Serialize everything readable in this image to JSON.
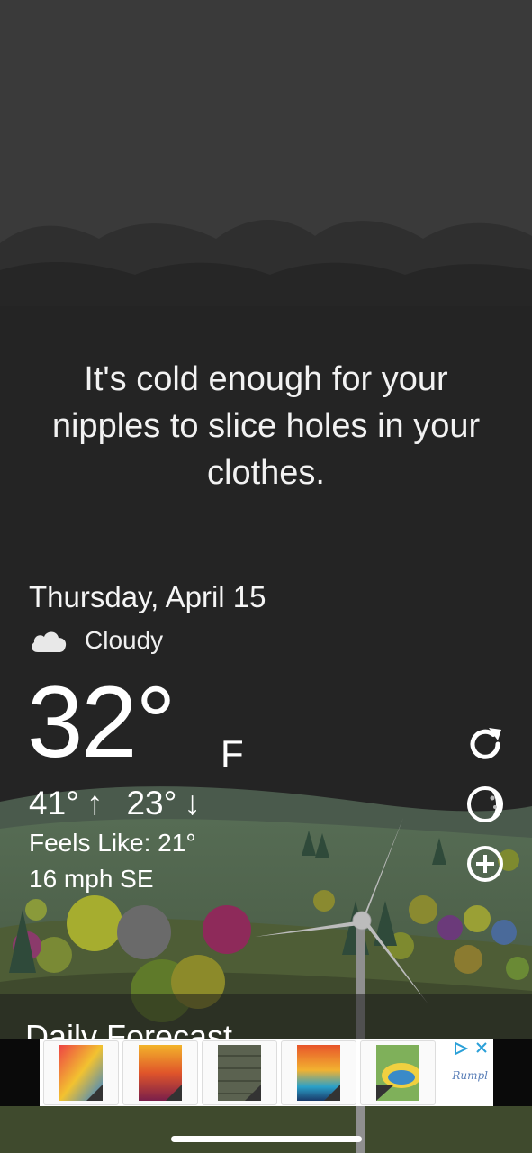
{
  "quote": "It's cold enough for your nipples to slice holes in your clothes.",
  "weather": {
    "date": "Thursday, April 15",
    "condition": "Cloudy",
    "condition_icon": "cloud-icon",
    "temperature": "32°",
    "unit": "F",
    "high": "41°",
    "high_arrow": "↑",
    "low": "23°",
    "low_arrow": "↓",
    "feels_like": "Feels Like: 21°",
    "wind": "16 mph SE"
  },
  "side_buttons": {
    "refresh_icon": "refresh-icon",
    "moon_icon": "moon-phase-icon",
    "add_icon": "add-location-icon"
  },
  "forecast": {
    "label": "Daily Forecast"
  },
  "ad": {
    "brand": "Rumpl"
  },
  "colors": {
    "background": "#242424",
    "sky_cloud": "#3b3b3b",
    "text": "#ffffff",
    "ad_link": "#5a7fb8"
  }
}
